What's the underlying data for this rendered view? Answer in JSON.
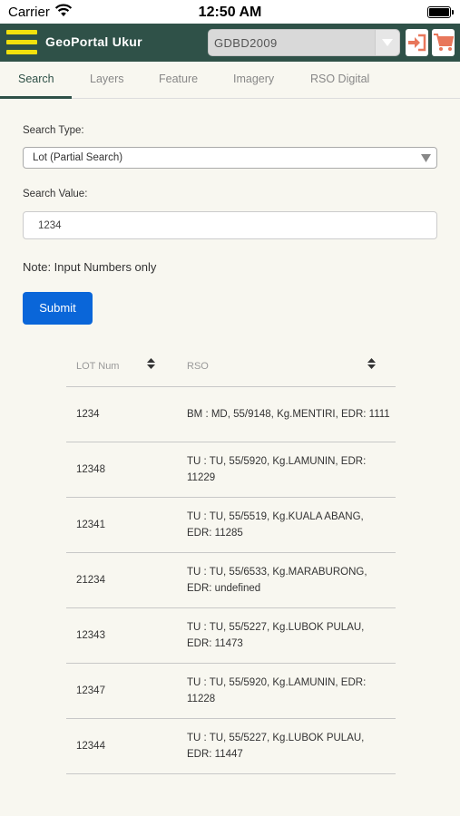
{
  "status_bar": {
    "carrier": "Carrier",
    "time": "12:50 AM"
  },
  "header": {
    "title": "GeoPortal Ukur",
    "dataset_value": "GDBD2009",
    "menu_icon": "hamburger-icon",
    "login_icon": "login-arrow-icon",
    "cart_icon": "cart-icon",
    "accent_color": "#f2e10d",
    "header_color": "#2f5148",
    "icon_color": "#e8775b"
  },
  "tabs": [
    {
      "label": "Search",
      "active": true
    },
    {
      "label": "Layers",
      "active": false
    },
    {
      "label": "Feature",
      "active": false
    },
    {
      "label": "Imagery",
      "active": false
    },
    {
      "label": "RSO Digital",
      "active": false
    }
  ],
  "form": {
    "search_type_label": "Search Type:",
    "search_type_value": "Lot (Partial Search)",
    "search_value_label": "Search Value:",
    "search_value": "1234",
    "note": "Note: Input Numbers only",
    "submit_label": "Submit",
    "submit_color": "#0a66d9"
  },
  "table": {
    "headers": [
      "LOT Num",
      "RSO"
    ],
    "rows": [
      {
        "lot": "1234",
        "rso": "BM : MD, 55/9148, Kg.MENTIRI, EDR: 1111"
      },
      {
        "lot": "12348",
        "rso": "TU : TU, 55/5920, Kg.LAMUNIN, EDR: 11229"
      },
      {
        "lot": "12341",
        "rso": "TU : TU, 55/5519, Kg.KUALA ABANG, EDR: 11285"
      },
      {
        "lot": "21234",
        "rso": "TU : TU, 55/6533, Kg.MARABURONG, EDR: undefined"
      },
      {
        "lot": "12343",
        "rso": "TU : TU, 55/5227, Kg.LUBOK PULAU, EDR: 11473"
      },
      {
        "lot": "12347",
        "rso": "TU : TU, 55/5920, Kg.LAMUNIN, EDR: 11228"
      },
      {
        "lot": "12344",
        "rso": "TU : TU, 55/5227, Kg.LUBOK PULAU, EDR: 11447"
      }
    ]
  }
}
